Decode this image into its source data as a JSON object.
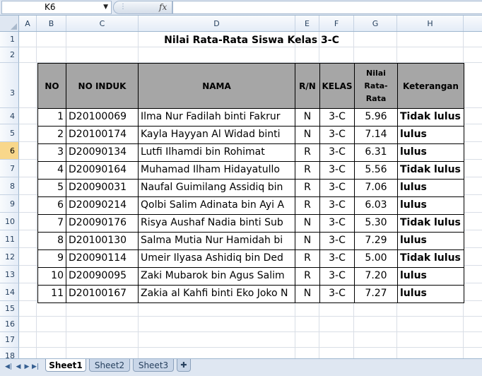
{
  "formula_bar": {
    "name_box": "K6",
    "fx_label": "fx",
    "formula": ""
  },
  "columns": [
    "A",
    "B",
    "C",
    "D",
    "E",
    "F",
    "G",
    "H"
  ],
  "rows": [
    "1",
    "2",
    "3",
    "4",
    "5",
    "6",
    "7",
    "8",
    "9",
    "10",
    "11",
    "12",
    "13",
    "14",
    "15",
    "16",
    "17",
    "18"
  ],
  "active_row": "6",
  "sheet_title": "Nilai Rata-Rata Siswa Kelas 3-C",
  "table": {
    "headers": {
      "no": "NO",
      "no_induk": "NO INDUK",
      "nama": "NAMA",
      "rn": "R/N",
      "kelas": "KELAS",
      "nilai_line1": "Nilai",
      "nilai_line2": "Rata-",
      "nilai_line3": "Rata",
      "keterangan": "Keterangan"
    },
    "rows": [
      {
        "no": "1",
        "induk": "D20100069",
        "nama": "Ilma Nur Fadilah binti Fakrur",
        "rn": "N",
        "kelas": "3-C",
        "nilai": "5.96",
        "ket": "Tidak lulus"
      },
      {
        "no": "2",
        "induk": "D20100174",
        "nama": "Kayla Hayyan Al Widad binti",
        "rn": "N",
        "kelas": "3-C",
        "nilai": "7.14",
        "ket": "lulus"
      },
      {
        "no": "3",
        "induk": "D20090134",
        "nama": "Lutfi Ilhamdi bin Rohimat",
        "rn": "R",
        "kelas": "3-C",
        "nilai": "6.31",
        "ket": "lulus"
      },
      {
        "no": "4",
        "induk": "D20090164",
        "nama": "Muhamad Ilham Hidayatullo",
        "rn": "R",
        "kelas": "3-C",
        "nilai": "5.56",
        "ket": "Tidak lulus"
      },
      {
        "no": "5",
        "induk": "D20090031",
        "nama": "Naufal Guimilang Assidiq bin",
        "rn": "R",
        "kelas": "3-C",
        "nilai": "7.06",
        "ket": "lulus"
      },
      {
        "no": "6",
        "induk": "D20090214",
        "nama": "Qolbi Salim Adinata bin Ayi A",
        "rn": "R",
        "kelas": "3-C",
        "nilai": "6.03",
        "ket": "lulus"
      },
      {
        "no": "7",
        "induk": "D20090176",
        "nama": "Risya Aushaf Nadia binti Sub",
        "rn": "N",
        "kelas": "3-C",
        "nilai": "5.30",
        "ket": "Tidak lulus"
      },
      {
        "no": "8",
        "induk": "D20100130",
        "nama": "Salma Mutia Nur Hamidah bi",
        "rn": "N",
        "kelas": "3-C",
        "nilai": "7.29",
        "ket": "lulus"
      },
      {
        "no": "9",
        "induk": "D20090114",
        "nama": "Umeir Ilyasa Ashidiq bin Ded",
        "rn": "R",
        "kelas": "3-C",
        "nilai": "5.00",
        "ket": "Tidak lulus"
      },
      {
        "no": "10",
        "induk": "D20090095",
        "nama": "Zaki Mubarok bin Agus Salim",
        "rn": "R",
        "kelas": "3-C",
        "nilai": "7.20",
        "ket": "lulus"
      },
      {
        "no": "11",
        "induk": "D20100167",
        "nama": "Zakia al Kahfi binti Eko Joko N",
        "rn": "N",
        "kelas": "3-C",
        "nilai": "7.27",
        "ket": "lulus"
      }
    ]
  },
  "sheet_tabs": [
    "Sheet1",
    "Sheet2",
    "Sheet3"
  ],
  "active_tab": "Sheet1",
  "icons": {
    "nav_first": "first-sheet-icon",
    "nav_prev": "prev-sheet-icon",
    "nav_next": "next-sheet-icon",
    "nav_last": "last-sheet-icon",
    "insert_sheet": "insert-sheet-icon"
  }
}
